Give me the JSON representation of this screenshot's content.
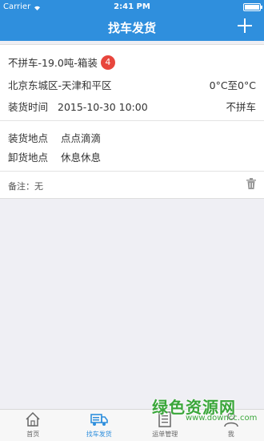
{
  "status_bar": {
    "carrier": "Carrier",
    "time": "2:41 PM"
  },
  "header": {
    "title": "找车发货",
    "add_icon": "plus-icon"
  },
  "shipment": {
    "title": "不拼车-19.0吨-箱装",
    "badge": "4",
    "route": "北京东城区-天津和平区",
    "temperature": "0°C至0°C",
    "time_label": "装货时间",
    "time_value": "2015-10-30 10:00",
    "carpool_status": "不拼车",
    "load_label": "装货地点",
    "load_value": "点点滴滴",
    "unload_label": "卸货地点",
    "unload_value": "休息休息",
    "remark": "备注：无",
    "delete_icon": "trash-icon"
  },
  "tabbar": {
    "items": [
      {
        "label": "首页",
        "icon": "home-icon"
      },
      {
        "label": "找车发货",
        "icon": "truck-icon"
      },
      {
        "label": "运单管理",
        "icon": "document-icon"
      },
      {
        "label": "我",
        "icon": "user-icon"
      }
    ]
  },
  "watermark": {
    "text": "绿色资源网",
    "url": "www.downcc.com"
  },
  "colors": {
    "primary": "#2f8fdd",
    "badge": "#e8463d",
    "watermark": "#3aa63a"
  }
}
